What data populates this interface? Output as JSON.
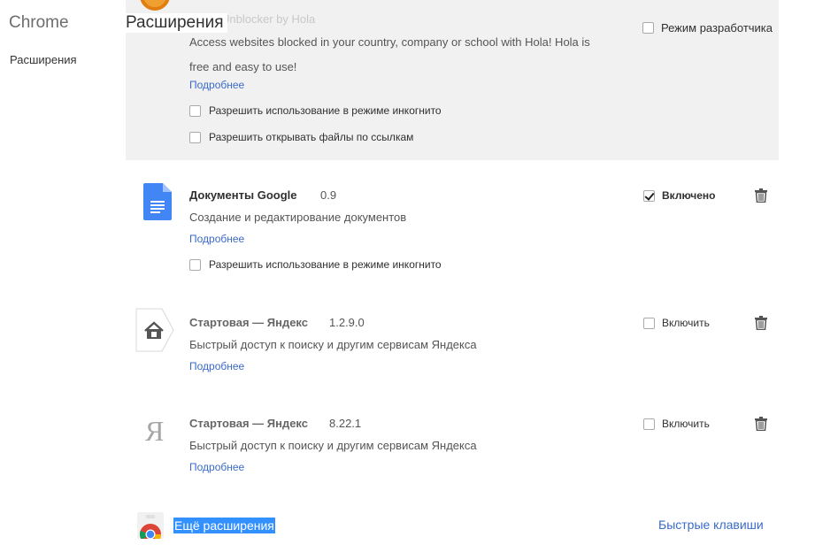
{
  "sidebar": {
    "title": "Chrome",
    "items": [
      {
        "label": "Расширения"
      }
    ]
  },
  "header": {
    "title": "Расширения",
    "ghost_text": "Unblocker by Hola",
    "dev_mode_label": "Режим разработчика",
    "dev_mode_checked": false
  },
  "extensions": [
    {
      "name": "Hola",
      "description": "Access websites blocked in your country, company or school with Hola! Hola is free and easy to use!",
      "details_link": "Подробнее",
      "options": [
        {
          "label": "Разрешить использование в режиме инкогнито",
          "checked": false
        },
        {
          "label": "Разрешить открывать файлы по ссылкам",
          "checked": false
        }
      ]
    },
    {
      "name": "Документы Google",
      "version": "0.9",
      "description": "Создание и редактирование документов",
      "details_link": "Подробнее",
      "enabled": true,
      "toggle_label": "Включено",
      "options": [
        {
          "label": "Разрешить использование в режиме инкогнито",
          "checked": false
        }
      ]
    },
    {
      "name": "Стартовая — Яндекс",
      "version": "1.2.9.0",
      "description": "Быстрый доступ к поиску и другим сервисам Яндекса",
      "details_link": "Подробнее",
      "enabled": false,
      "toggle_label": "Включить"
    },
    {
      "name": "Стартовая — Яндекс",
      "version": "8.22.1",
      "description": "Быстрый доступ к поиску и другим сервисам Яндекса",
      "details_link": "Подробнее",
      "enabled": false,
      "toggle_label": "Включить",
      "icon_glyph": "Я"
    }
  ],
  "footer": {
    "more_extensions_label": "Ещё расширения",
    "shortcuts_label": "Быстрые клавиши"
  },
  "colors": {
    "link": "#3a6bc8",
    "selection": "#3390ff",
    "disabled_block_bg": "#f1f1f1",
    "docs_blue": "#4285f4"
  },
  "icons": {
    "trash": "trash-icon",
    "docs": "google-docs-icon",
    "home": "yandex-home-icon",
    "store": "chrome-web-store-icon"
  }
}
